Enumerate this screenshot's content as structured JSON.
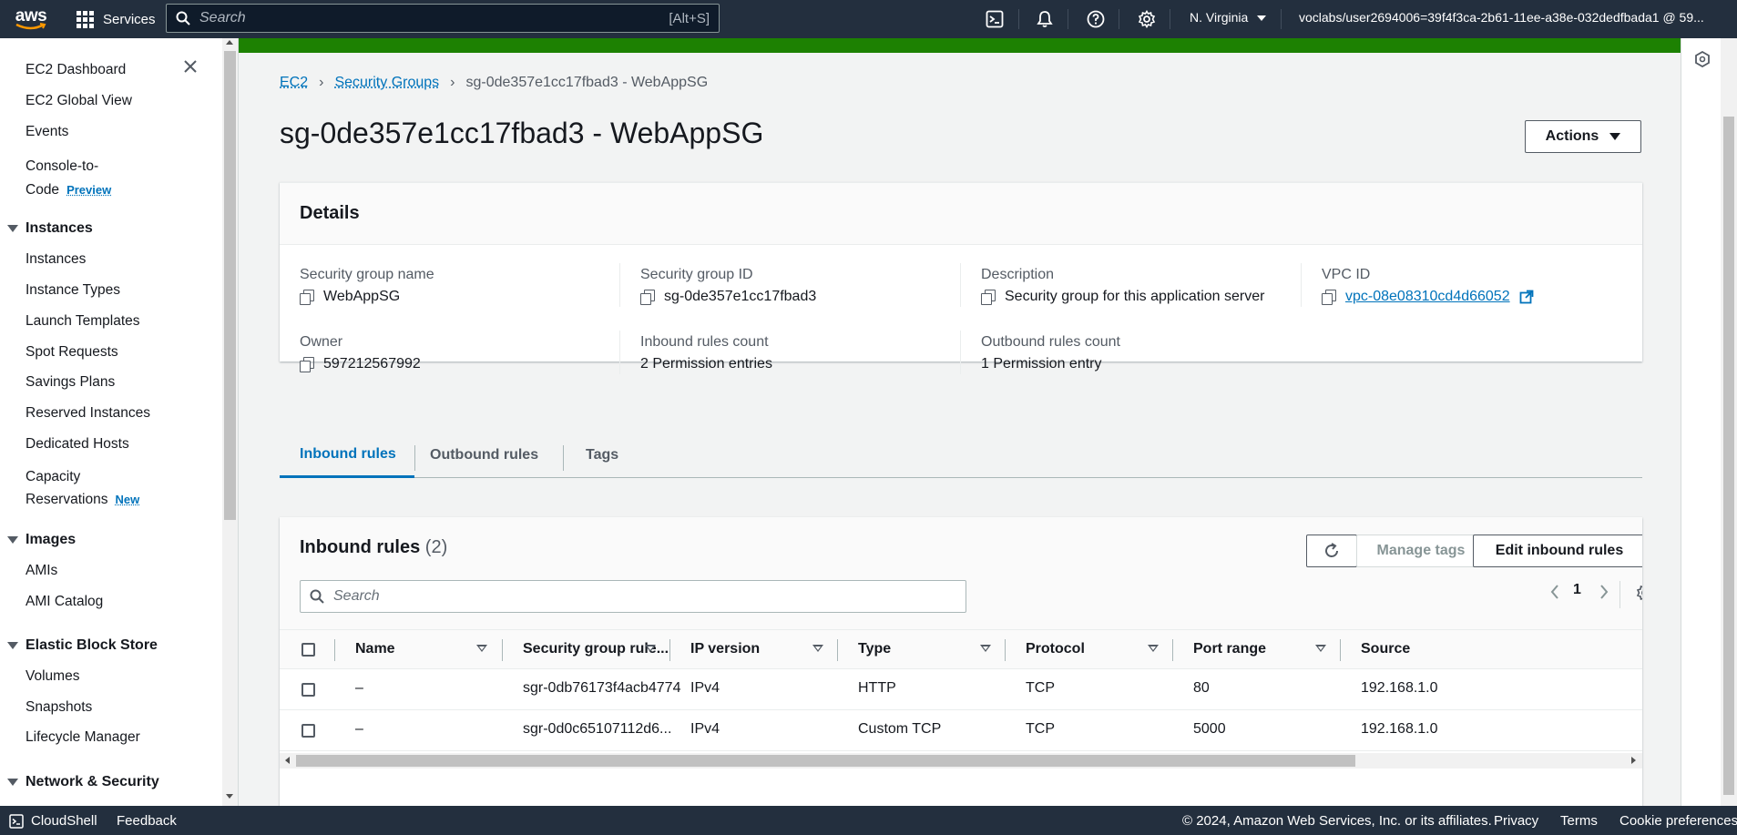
{
  "topnav": {
    "logo_text": "aws",
    "services_label": "Services",
    "search_placeholder": "Search",
    "search_shortcut": "[Alt+S]",
    "region": "N. Virginia",
    "account": "voclabs/user2694006=39f4f3ca-2b61-11ee-a38e-032dedfbada1 @ 59..."
  },
  "sidebar": {
    "top_items": [
      {
        "label": "EC2 Dashboard"
      },
      {
        "label": "EC2 Global View"
      },
      {
        "label": "Events"
      }
    ],
    "console_to_code": {
      "label_line1": "Console-to-",
      "label_line2": "Code",
      "badge": "Preview"
    },
    "sections": {
      "instances": {
        "title": "Instances",
        "items": [
          "Instances",
          "Instance Types",
          "Launch Templates",
          "Spot Requests",
          "Savings Plans",
          "Reserved Instances",
          "Dedicated Hosts"
        ]
      },
      "capacity": {
        "label_line1": "Capacity",
        "label_line2": "Reservations",
        "badge": "New"
      },
      "images": {
        "title": "Images",
        "items": [
          "AMIs",
          "AMI Catalog"
        ]
      },
      "ebs": {
        "title": "Elastic Block Store",
        "items": [
          "Volumes",
          "Snapshots",
          "Lifecycle Manager"
        ]
      },
      "network": {
        "title": "Network & Security"
      }
    }
  },
  "breadcrumb": {
    "root": "EC2",
    "parent": "Security Groups",
    "current": "sg-0de357e1cc17fbad3 - WebAppSG"
  },
  "page": {
    "title": "sg-0de357e1cc17fbad3 - WebAppSG",
    "actions_label": "Actions"
  },
  "details": {
    "heading": "Details",
    "sg_name_label": "Security group name",
    "sg_name": "WebAppSG",
    "sg_id_label": "Security group ID",
    "sg_id": "sg-0de357e1cc17fbad3",
    "description_label": "Description",
    "description": "Security group for this application server",
    "vpc_label": "VPC ID",
    "vpc_id": "vpc-08e08310cd4d66052",
    "owner_label": "Owner",
    "owner": "597212567992",
    "inbound_count_label": "Inbound rules count",
    "inbound_count": "2 Permission entries",
    "outbound_count_label": "Outbound rules count",
    "outbound_count": "1 Permission entry"
  },
  "tabs": [
    {
      "label": "Inbound rules",
      "active": true
    },
    {
      "label": "Outbound rules",
      "active": false
    },
    {
      "label": "Tags",
      "active": false
    }
  ],
  "inbound": {
    "title": "Inbound rules",
    "count": "(2)",
    "manage_tags_label": "Manage tags",
    "edit_label": "Edit inbound rules",
    "search_placeholder": "Search",
    "page_number": "1",
    "columns": [
      "Name",
      "Security group rule...",
      "IP version",
      "Type",
      "Protocol",
      "Port range",
      "Source"
    ],
    "rows": [
      {
        "name": "–",
        "rule_id": "sgr-0db76173f4acb4774",
        "ip_version": "IPv4",
        "type": "HTTP",
        "protocol": "TCP",
        "port_range": "80",
        "source": "192.168.1.0"
      },
      {
        "name": "–",
        "rule_id": "sgr-0d0c65107112d6...",
        "ip_version": "IPv4",
        "type": "Custom TCP",
        "protocol": "TCP",
        "port_range": "5000",
        "source": "192.168.1.0"
      }
    ]
  },
  "footer": {
    "cloudshell": "CloudShell",
    "feedback": "Feedback",
    "copyright": "© 2024, Amazon Web Services, Inc. or its affiliates.",
    "privacy": "Privacy",
    "terms": "Terms",
    "cookies": "Cookie preferences"
  },
  "colors": {
    "nav_bg": "#232f3e",
    "link": "#0073bb",
    "success_bar": "#1d8102"
  }
}
